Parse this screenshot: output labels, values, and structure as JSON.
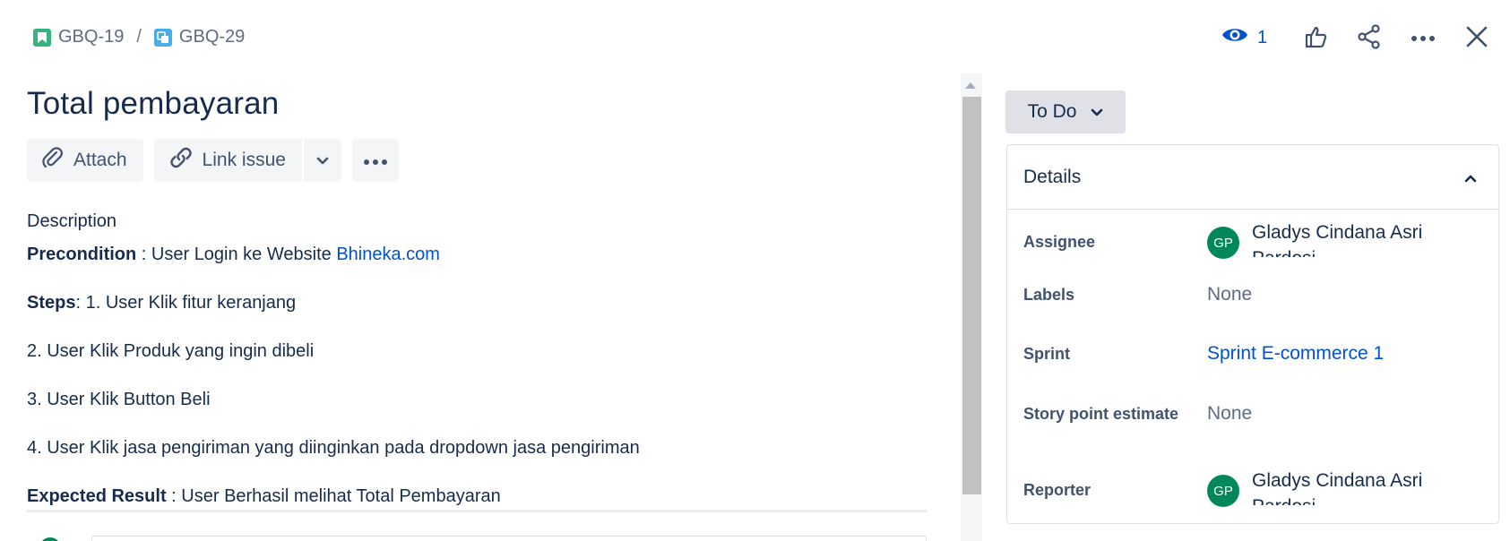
{
  "breadcrumb": {
    "parent": {
      "key": "GBQ-19",
      "icon": "story-icon",
      "color": "#36b37e"
    },
    "separator": "/",
    "current": {
      "key": "GBQ-29",
      "icon": "subtask-icon",
      "color": "#4bade8"
    }
  },
  "actions": {
    "watch_count": "1",
    "icons": [
      "eye-icon",
      "thumbs-up-icon",
      "share-icon",
      "more-icon",
      "close-icon"
    ]
  },
  "issue": {
    "title": "Total pembayaran"
  },
  "toolbar": {
    "attach_label": "Attach",
    "link_issue_label": "Link issue"
  },
  "description": {
    "label": "Description",
    "precondition_label": "Precondition",
    "precondition_text": " : User Login ke Website ",
    "precondition_link": "Bhineka.com",
    "steps_label": "Steps",
    "step1": ":  1. User Klik fitur keranjang",
    "step2": "2. User Klik Produk yang ingin dibeli",
    "step3": "3. User Klik Button Beli",
    "step4": "4. User Klik jasa pengiriman yang diinginkan pada dropdown jasa pengiriman",
    "expected_label": "Expected Result",
    "expected_text": " : User Berhasil melihat Total Pembayaran"
  },
  "status": {
    "label": "To Do"
  },
  "details": {
    "title": "Details",
    "assignee_label": "Assignee",
    "assignee_initials": "GP",
    "assignee_name": "Gladys Cindana Asri Pardosi",
    "labels_label": "Labels",
    "labels_value": "None",
    "sprint_label": "Sprint",
    "sprint_value": "Sprint E-commerce 1",
    "story_points_label": "Story point estimate",
    "story_points_value": "None",
    "reporter_label": "Reporter",
    "reporter_initials": "GP",
    "reporter_name": "Gladys Cindana Asri Pardosi"
  },
  "colors": {
    "link": "#0052cc",
    "avatar": "#00875a",
    "text": "#172b4d"
  }
}
